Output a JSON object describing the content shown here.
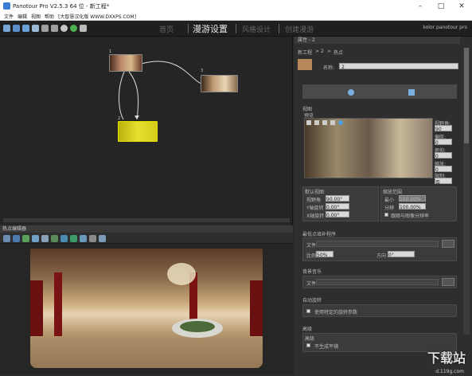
{
  "window": {
    "title": "Panotour Pro V2.5.3 64 位 - 新工程*",
    "minimize_label": "–",
    "maximize_label": "□",
    "close_label": "✕"
  },
  "menu": {
    "file": "文件",
    "edit": "编辑",
    "view": "视图",
    "help": "帮助",
    "crack_note": "[大智慧汉化版 WWW.DXXPS.COM]"
  },
  "nav": {
    "home": "首页",
    "tour_settings": "漫游设置",
    "style_design": "风格设计",
    "create_tour": "创建漫游",
    "logo": "kolor panotour pro"
  },
  "graph": {
    "node1": "1",
    "node2": "2",
    "node3": "3"
  },
  "hotspot_editor": {
    "title": "热点编辑器"
  },
  "properties": {
    "header": "属性 - 2",
    "breadcrumb_root": "新工程",
    "breadcrumb_sep": ">",
    "breadcrumb_num": "2",
    "breadcrumb_arrow": ">",
    "breadcrumb_current": "热点",
    "name_label": "名称:",
    "name_value": "2",
    "view_section": "视图",
    "preview_label": "预览",
    "fov_label": "视野角:",
    "fov_value": "90",
    "pan_label": "偏航:",
    "pan_value": "0",
    "tilt_label": "俯仰:",
    "tilt_value": "0",
    "zoom_label": "缩放:",
    "zoom_value": "0",
    "limit_label": "限制:",
    "limit_value": "否",
    "default_view": "默认视图",
    "fov_field_label": "视野角",
    "fov_field_value": "90.00°",
    "yaw_label": "Y轴旋转",
    "yaw_value": "0.00°",
    "pitch_label": "X轴旋转",
    "pitch_value": "0.00°",
    "zoom_range": "缩放范围",
    "min_label": "最小",
    "min_value": "100.00%",
    "max_label": "分辨",
    "max_value": "100.00%",
    "match_label": "跟随与图像分辨率",
    "min_hotspot_section": "最低点填补程序",
    "file_label": "文件",
    "scale_label": "比例",
    "scale_value": "50%",
    "rotate_label": "方向",
    "rotate_value": "0°",
    "bg_music_section": "背景音乐",
    "bg_file_label": "文件",
    "auto_rotate_section": "自动旋转",
    "auto_rotate_check": "使用特定的旋转参数",
    "advanced_section": "高级",
    "advanced_label": "高级",
    "no_thumb_check": "不生成平铺"
  },
  "watermark": {
    "text": "下载站",
    "url": "d.119g.com"
  }
}
